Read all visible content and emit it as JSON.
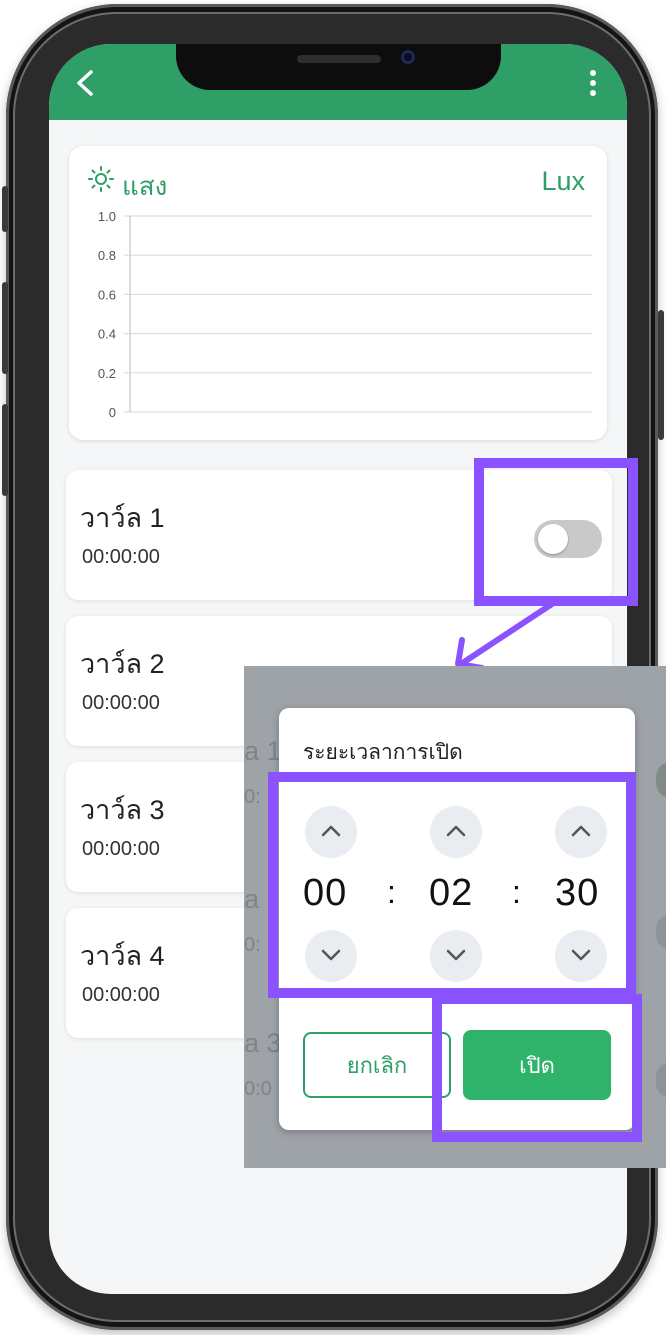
{
  "colors": {
    "accent": "#2e9f67",
    "highlight": "#8b53ff",
    "button_primary": "#2fb36b"
  },
  "light_card": {
    "title": "แสง",
    "unit": "Lux",
    "icon": "sun-icon"
  },
  "chart_data": {
    "type": "line",
    "title": "แสง",
    "ylabel": "",
    "xlabel": "",
    "y_ticks": [
      "1.0",
      "0.8",
      "0.6",
      "0.4",
      "0.2",
      "0"
    ],
    "ylim": [
      0,
      1.0
    ],
    "series": [],
    "grid": true
  },
  "valves": [
    {
      "name": "วาว์ล 1",
      "time": "00:00:00",
      "toggle_on": false
    },
    {
      "name": "วาว์ล 2",
      "time": "00:00:00"
    },
    {
      "name": "วาว์ล 3",
      "time": "00:00:00"
    },
    {
      "name": "วาว์ล 4",
      "time": "00:00:00"
    }
  ],
  "dialog": {
    "title": "ระยะเวลาการเปิด",
    "hours": "00",
    "minutes": "02",
    "seconds": "30",
    "separator": ":",
    "cancel_label": "ยกเลิก",
    "open_label": "เปิด"
  },
  "ghost": {
    "a1": "a 1",
    "a2": "a",
    "a3": "a 3",
    "o1": "0:",
    "o2": "0:",
    "o3": "0:0"
  }
}
